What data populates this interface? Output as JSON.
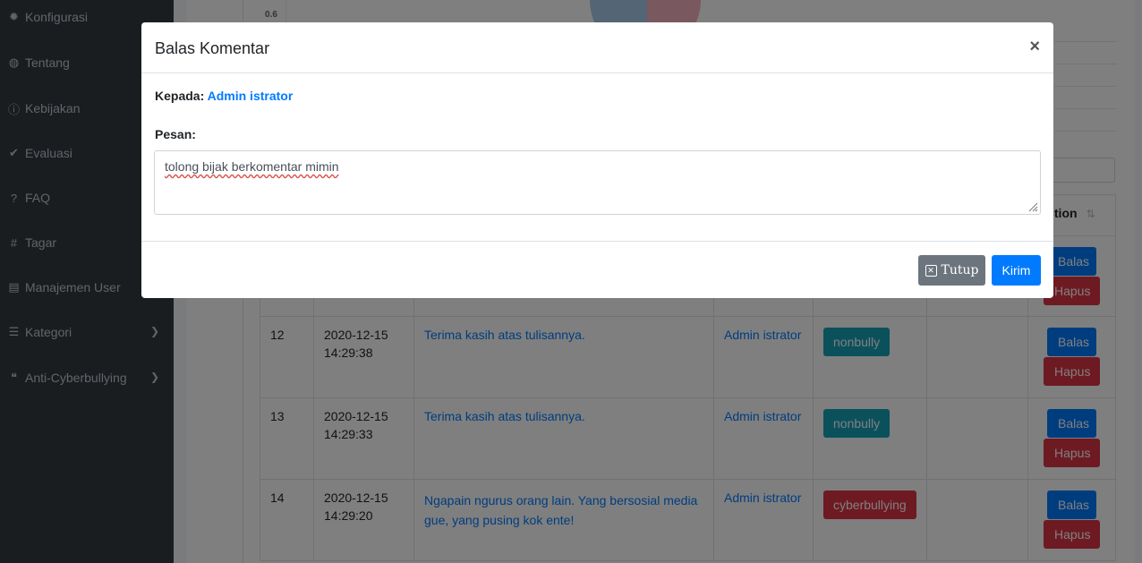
{
  "sidebar": {
    "items": [
      {
        "label": "Konfigurasi",
        "icon": "gear-icon"
      },
      {
        "label": "Tentang",
        "icon": "globe-icon"
      },
      {
        "label": "Kebijakan",
        "icon": "info-icon"
      },
      {
        "label": "Evaluasi",
        "icon": "check-circle-icon"
      },
      {
        "label": "FAQ",
        "icon": "question-icon"
      },
      {
        "label": "Tagar",
        "icon": "hashtag-icon"
      },
      {
        "label": "Manajemen User",
        "icon": "id-card-icon"
      },
      {
        "label": "Kategori",
        "icon": "list-icon"
      },
      {
        "label": "Anti-Cyberbullying",
        "icon": "comments-icon"
      }
    ]
  },
  "chart": {
    "tick_label": "0.6"
  },
  "table": {
    "action_header": "Action",
    "sort_icon": "⇅",
    "rows": [
      {
        "no": "12",
        "date": "2020-12-15",
        "time": "14:29:38",
        "comment": "Terima kasih atas tulisannya.",
        "user": "Admin istrator",
        "label": "nonbully",
        "label_color": "#17a2b8"
      },
      {
        "no": "13",
        "date": "2020-12-15",
        "time": "14:29:33",
        "comment": "Terima kasih atas tulisannya.",
        "user": "Admin istrator",
        "label": "nonbully",
        "label_color": "#17a2b8"
      },
      {
        "no": "14",
        "date": "2020-12-15",
        "time": "14:29:20",
        "comment": "Ngapain ngurus orang lain. Yang bersosial media gue, yang pusing kok ente!",
        "user": "Admin istrator",
        "label": "cyberbullying",
        "label_color": "#dc3545"
      }
    ],
    "balas_label": "Balas",
    "hapus_label": "Hapus"
  },
  "modal": {
    "title": "Balas Komentar",
    "close_symbol": "×",
    "kepada_label": "Kepada:",
    "kepada_value": "Admin istrator",
    "pesan_label": "Pesan:",
    "message": "tolong bijak berkomentar mimin",
    "tutup_label": "Tutup",
    "kirim_label": "Kirim"
  },
  "colors": {
    "primary": "#007bff",
    "danger": "#dc3545",
    "info": "#17a2b8",
    "secondary": "#6c757d",
    "sidebar_bg": "#343a40"
  }
}
